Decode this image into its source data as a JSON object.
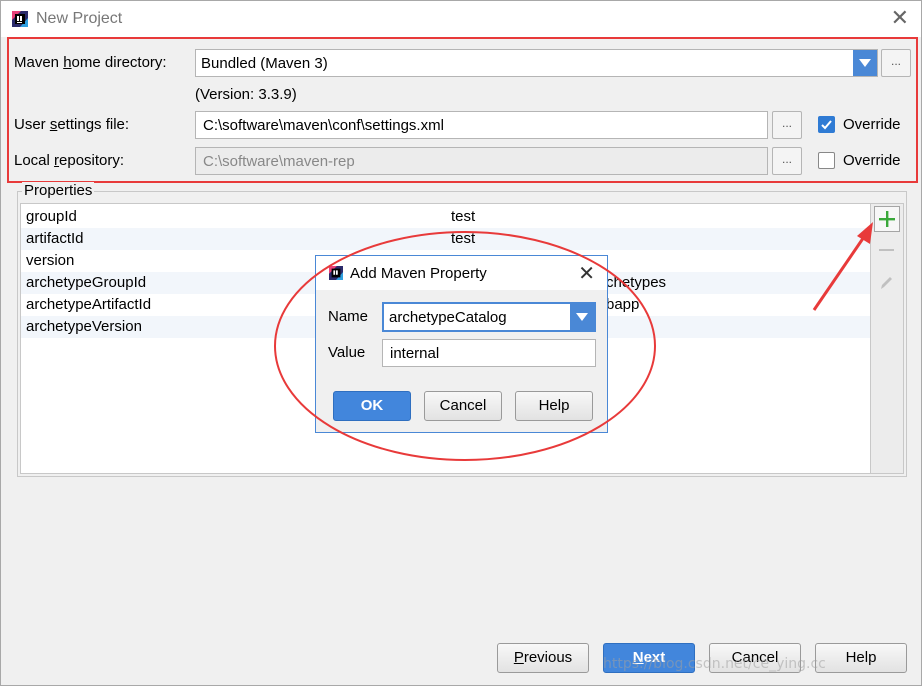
{
  "window": {
    "title": "New Project",
    "close_glyph": "✕"
  },
  "maven": {
    "home_label_pre": "Maven ",
    "home_label_u": "h",
    "home_label_post": "ome directory:",
    "home_value": "Bundled (Maven 3)",
    "version_text": "(Version: 3.3.9)",
    "settings_label_pre": "User ",
    "settings_label_u": "s",
    "settings_label_post": "ettings file:",
    "settings_value": "C:\\software\\maven\\conf\\settings.xml",
    "settings_override": "Override",
    "settings_override_checked": true,
    "repo_label_pre": "Local ",
    "repo_label_u": "r",
    "repo_label_post": "epository:",
    "repo_value": "C:\\software\\maven-rep",
    "repo_override": "Override",
    "repo_override_checked": false,
    "browse_glyph": "..."
  },
  "properties": {
    "title": "Properties",
    "rows": [
      {
        "key": "groupId",
        "value": "test"
      },
      {
        "key": "artifactId",
        "value": "test"
      },
      {
        "key": "version",
        "value": ""
      },
      {
        "key": "archetypeGroupId",
        "value": "chetypes"
      },
      {
        "key": "archetypeArtifactId",
        "value": "bapp"
      },
      {
        "key": "archetypeVersion",
        "value": ""
      }
    ]
  },
  "dialog": {
    "title": "Add Maven Property",
    "close_glyph": "✕",
    "name_label": "Name",
    "name_value": "archetypeCatalog",
    "value_label": "Value",
    "value_value": "internal",
    "ok": "OK",
    "cancel": "Cancel",
    "help": "Help"
  },
  "footer": {
    "previous_u": "P",
    "previous_rest": "revious",
    "next_u": "N",
    "next_rest": "ext",
    "cancel": "Cancel",
    "help": "Help"
  },
  "watermark": "https://blog.csdn.net/ce_ying.cc",
  "colors": {
    "accent": "#4a88d6",
    "annotation": "#e83a3a",
    "add_icon": "#3aa83a"
  }
}
